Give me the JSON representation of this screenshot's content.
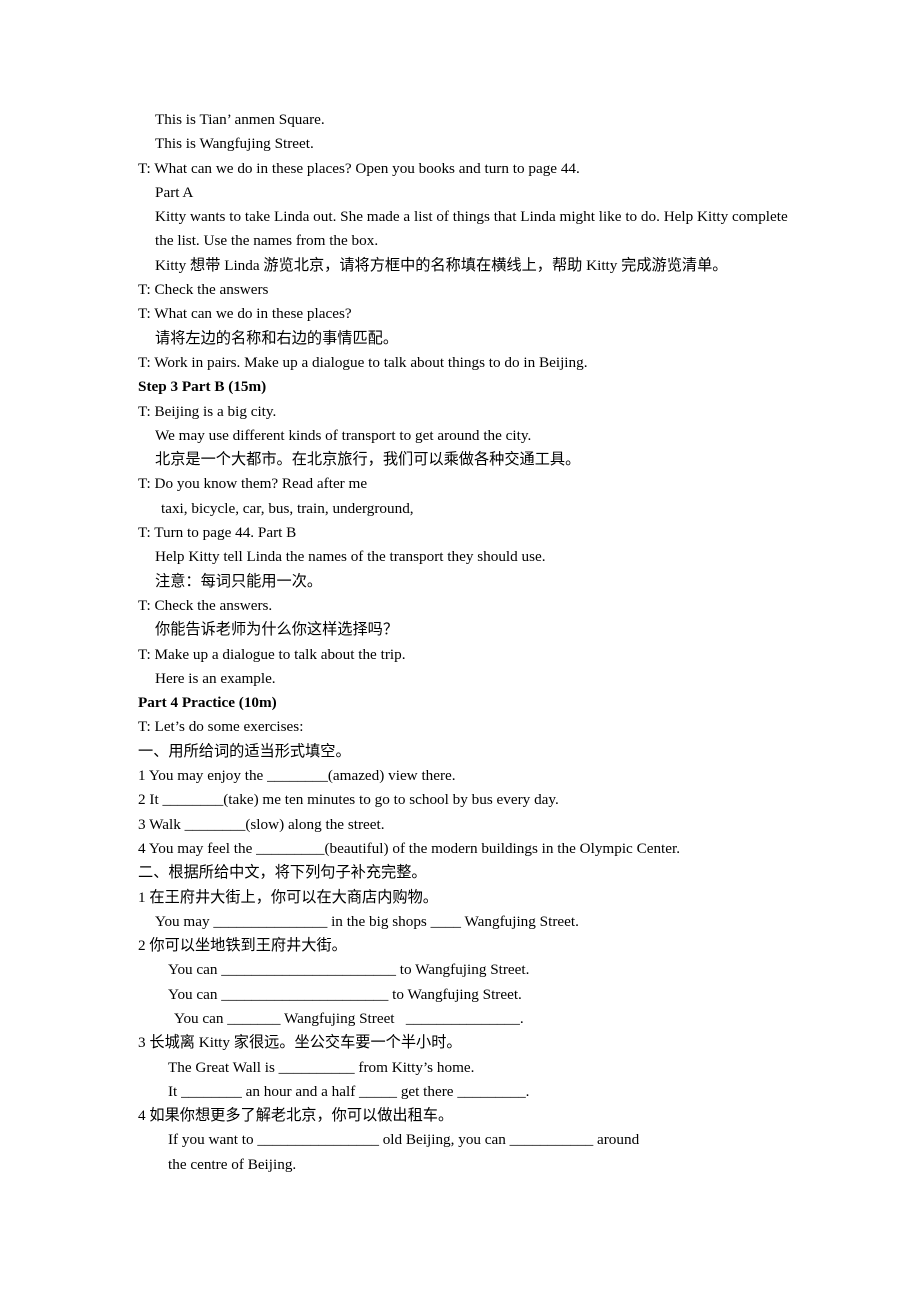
{
  "document": {
    "type": "lesson-plan",
    "language": "en-zh",
    "lines": [
      {
        "id": "l01",
        "indent": 1,
        "bold": false,
        "text": "This is Tian’ anmen Square."
      },
      {
        "id": "l02",
        "indent": 1,
        "bold": false,
        "text": "This is Wangfujing Street."
      },
      {
        "id": "l03",
        "indent": 0,
        "bold": false,
        "text": "T: What can we do in these places? Open you books and turn to page 44."
      },
      {
        "id": "l04",
        "indent": 1,
        "bold": false,
        "text": "Part A"
      },
      {
        "id": "l05",
        "indent": 1,
        "bold": false,
        "wrap": true,
        "text": "Kitty wants to take Linda out. She made a list of things that Linda might like to do. Help Kitty complete the list. Use the names from the box."
      },
      {
        "id": "l06",
        "indent": 1,
        "bold": false,
        "text": "Kitty 想带 Linda 游览北京，请将方框中的名称填在横线上，帮助 Kitty 完成游览清单。"
      },
      {
        "id": "l07",
        "indent": 0,
        "bold": false,
        "text": "T: Check the answers"
      },
      {
        "id": "l08",
        "indent": 0,
        "bold": false,
        "text": "T: What can we do in these places?"
      },
      {
        "id": "l09",
        "indent": 1,
        "bold": false,
        "text": "请将左边的名称和右边的事情匹配。"
      },
      {
        "id": "l10",
        "indent": 0,
        "bold": false,
        "text": "T: Work in pairs. Make up a dialogue to talk about things to do in Beijing."
      },
      {
        "id": "l11",
        "indent": 0,
        "bold": true,
        "text": "Step 3 Part B (15m)"
      },
      {
        "id": "l12",
        "indent": 0,
        "bold": false,
        "text": "T: Beijing is a big city."
      },
      {
        "id": "l13",
        "indent": 1,
        "bold": false,
        "text": "We may use different kinds of transport to get around the city."
      },
      {
        "id": "l14",
        "indent": 1,
        "bold": false,
        "text": "北京是一个大都市。在北京旅行，我们可以乘做各种交通工具。"
      },
      {
        "id": "l15",
        "indent": 0,
        "bold": false,
        "text": "T: Do you know them? Read after me"
      },
      {
        "id": "l16",
        "indent": 2,
        "bold": false,
        "text": "taxi, bicycle, car, bus, train, underground,"
      },
      {
        "id": "l17",
        "indent": 0,
        "bold": false,
        "text": "T: Turn to page 44. Part B"
      },
      {
        "id": "l18",
        "indent": 1,
        "bold": false,
        "text": "Help Kitty tell Linda the names of the transport they should use."
      },
      {
        "id": "l19",
        "indent": 1,
        "bold": false,
        "text": "注意：每词只能用一次。"
      },
      {
        "id": "l20",
        "indent": 0,
        "bold": false,
        "text": "T: Check the answers."
      },
      {
        "id": "l21",
        "indent": 1,
        "bold": false,
        "text": "你能告诉老师为什么你这样选择吗？"
      },
      {
        "id": "l22",
        "indent": 0,
        "bold": false,
        "text": "T: Make up a dialogue to talk about the trip."
      },
      {
        "id": "l23",
        "indent": 1,
        "bold": false,
        "text": "Here is an example."
      },
      {
        "id": "l24",
        "indent": 0,
        "bold": true,
        "text": "Part 4 Practice (10m)"
      },
      {
        "id": "l25",
        "indent": 0,
        "bold": false,
        "text": "T: Let’s do some exercises:"
      },
      {
        "id": "l26",
        "indent": 0,
        "bold": false,
        "text": "一、用所给词的适当形式填空。"
      },
      {
        "id": "l27",
        "indent": 0,
        "bold": false,
        "text": "1 You may enjoy the ________(amazed) view there."
      },
      {
        "id": "l28",
        "indent": 0,
        "bold": false,
        "text": "2 It ________(take) me ten minutes to go to school by bus every day."
      },
      {
        "id": "l29",
        "indent": 0,
        "bold": false,
        "text": "3 Walk ________(slow) along the street."
      },
      {
        "id": "l30",
        "indent": 0,
        "bold": false,
        "text": "4 You may feel the _________(beautiful) of the modern buildings in the Olympic Center."
      },
      {
        "id": "l31",
        "indent": 0,
        "bold": false,
        "text": "二、根据所给中文，将下列句子补充完整。"
      },
      {
        "id": "l32",
        "indent": 0,
        "bold": false,
        "text": "1 在王府井大街上，你可以在大商店内购物。"
      },
      {
        "id": "l33",
        "indent": 1,
        "bold": false,
        "text": "You may _______________ in the big shops ____ Wangfujing Street."
      },
      {
        "id": "l34",
        "indent": 0,
        "bold": false,
        "text": "2 你可以坐地铁到王府井大街。"
      },
      {
        "id": "l35",
        "indent": 3,
        "bold": false,
        "text": "You can _______________________ to Wangfujing Street."
      },
      {
        "id": "l36",
        "indent": 3,
        "bold": false,
        "text": "You can ______________________ to Wangfujing Street."
      },
      {
        "id": "l37",
        "indent": 4,
        "bold": false,
        "text": "You can _______ Wangfujing Street   _______________."
      },
      {
        "id": "l38",
        "indent": 0,
        "bold": false,
        "text": "3 长城离 Kitty 家很远。坐公交车要一个半小时。"
      },
      {
        "id": "l39",
        "indent": 3,
        "bold": false,
        "text": "The Great Wall is __________ from Kitty’s home."
      },
      {
        "id": "l40",
        "indent": 3,
        "bold": false,
        "text": "It ________ an hour and a half _____ get there _________."
      },
      {
        "id": "l41",
        "indent": 0,
        "bold": false,
        "text": "4 如果你想更多了解老北京，你可以做出租车。"
      },
      {
        "id": "l42",
        "indent": 3,
        "bold": false,
        "text": "If you want to ________________ old Beijing, you can ___________ around"
      },
      {
        "id": "l43",
        "indent": 3,
        "bold": false,
        "text": "the centre of Beijing."
      }
    ]
  }
}
